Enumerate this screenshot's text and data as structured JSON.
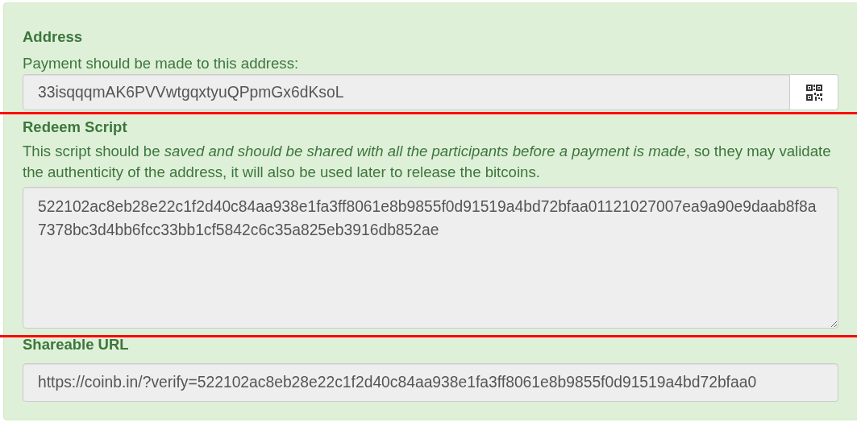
{
  "address": {
    "heading": "Address",
    "description": "Payment should be made to this address:",
    "value": "33isqqqmAK6PVVwtgqxtyuQPpmGx6dKsoL"
  },
  "redeem_script": {
    "heading": "Redeem Script",
    "description": "This script should be *saved and should be shared with all the participants before a payment is made*, so they may validate the authenticity of the address, it will also be used later to release the bitcoins.",
    "value": "522102ac8eb28e22c1f2d40c84aa938e1fa3ff8061e8b9855f0d91519a4bd72bfaa01121027007ea9a90e9daab8f8a7378bc3d4bb6fcc33bb1cf5842c6c35a825eb3916db852ae"
  },
  "shareable_url": {
    "heading": "Shareable URL",
    "value": "https://coinb.in/?verify=522102ac8eb28e22c1f2d40c84aa938e1fa3ff8061e8b9855f0d91519a4bd72bfaa0"
  }
}
